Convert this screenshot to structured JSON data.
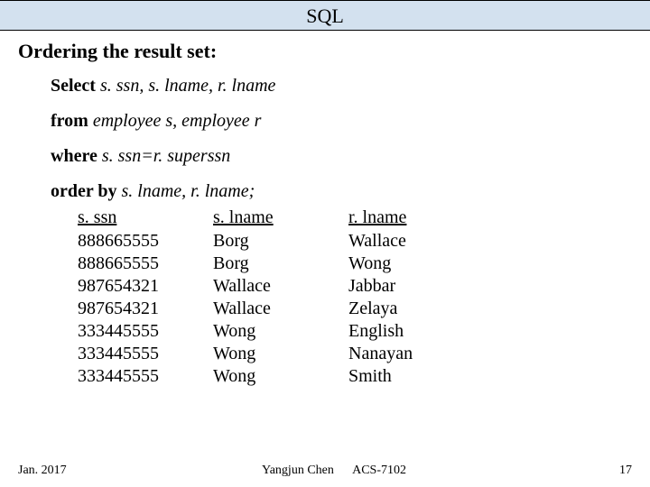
{
  "title": "SQL",
  "heading": "Ordering the result set:",
  "query": {
    "select_kw": "Select",
    "select_cols": "s. ssn, s. lname, r. lname",
    "from_kw": "from",
    "from_body": "employee s, employee r",
    "where_kw": "where",
    "where_body": "s. ssn=r. superssn",
    "orderby_kw": "order by",
    "orderby_body": "s. lname, r. lname;"
  },
  "table": {
    "headers": {
      "ssn": "s. ssn",
      "slname": "s. lname",
      "rlname": "r. lname"
    },
    "rows": [
      {
        "ssn": "888665555",
        "slname": "Borg",
        "rlname": "Wallace"
      },
      {
        "ssn": "888665555",
        "slname": "Borg",
        "rlname": "Wong"
      },
      {
        "ssn": "987654321",
        "slname": "Wallace",
        "rlname": "Jabbar"
      },
      {
        "ssn": "987654321",
        "slname": "Wallace",
        "rlname": "Zelaya"
      },
      {
        "ssn": "333445555",
        "slname": "Wong",
        "rlname": "English"
      },
      {
        "ssn": "333445555",
        "slname": "Wong",
        "rlname": "Nanayan"
      },
      {
        "ssn": "333445555",
        "slname": "Wong",
        "rlname": "Smith"
      }
    ]
  },
  "footer": {
    "date": "Jan. 2017",
    "author": "Yangjun Chen",
    "course": "ACS-7102",
    "page": "17"
  }
}
